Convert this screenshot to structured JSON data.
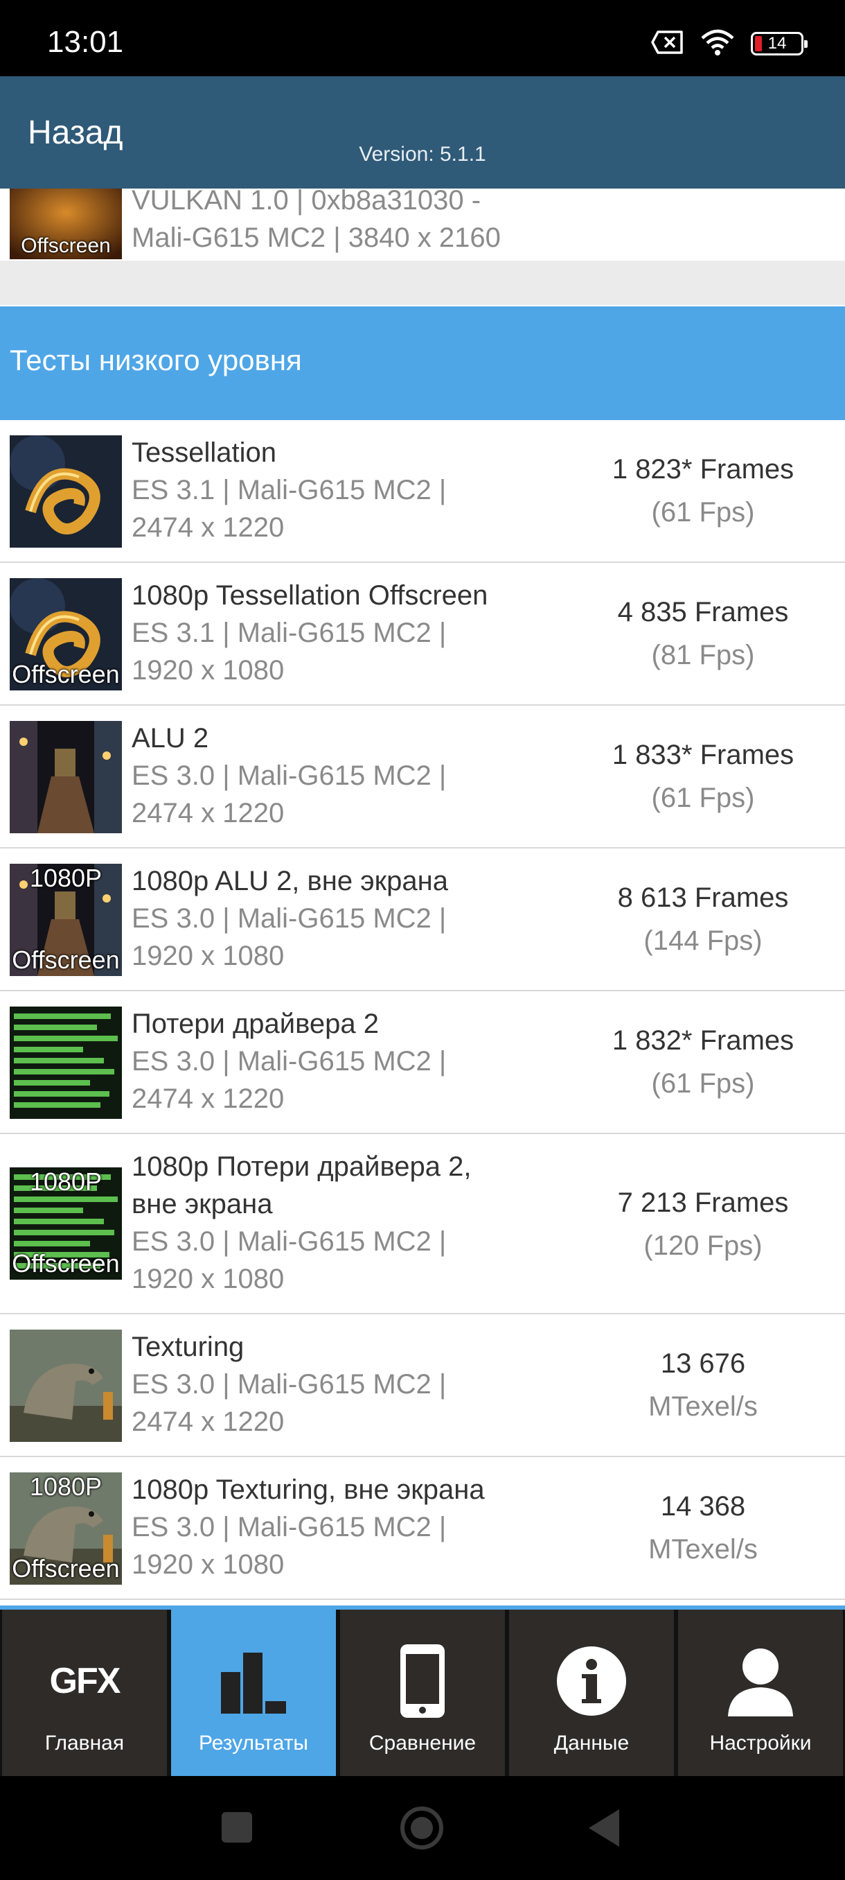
{
  "status_bar": {
    "time": "13:01",
    "battery": "14"
  },
  "header": {
    "back": "Назад",
    "version": "Version: 5.1.1"
  },
  "previous_item": {
    "thumb_label": "Offscreen",
    "line1": "VULKAN 1.0 | 0xb8a31030 -",
    "line2": "Mali-G615 MC2 | 3840 x 2160"
  },
  "section": {
    "title": "Тесты низкого уровня"
  },
  "tests": [
    {
      "title": "Tessellation",
      "sub1": "ES 3.1 | Mali-G615 MC2 |",
      "sub2": "2474 x 1220",
      "result": "1 823* Frames",
      "result_sub": "(61 Fps)",
      "thumb": "tess",
      "badge_top": "",
      "badge_bottom": ""
    },
    {
      "title": "1080p Tessellation Offscreen",
      "sub1": "ES 3.1 | Mali-G615 MC2 |",
      "sub2": "1920 x 1080",
      "result": "4 835 Frames",
      "result_sub": "(81 Fps)",
      "thumb": "tess",
      "badge_top": "",
      "badge_bottom": "Offscreen"
    },
    {
      "title": "ALU 2",
      "sub1": "ES 3.0 | Mali-G615 MC2 |",
      "sub2": "2474 x 1220",
      "result": "1 833* Frames",
      "result_sub": "(61 Fps)",
      "thumb": "alu",
      "badge_top": "",
      "badge_bottom": ""
    },
    {
      "title": "1080p ALU 2, вне экрана",
      "sub1": "ES 3.0 | Mali-G615 MC2 |",
      "sub2": "1920 x 1080",
      "result": "8 613 Frames",
      "result_sub": "(144 Fps)",
      "thumb": "alu",
      "badge_top": "1080P",
      "badge_bottom": "Offscreen"
    },
    {
      "title": "Потери драйвера 2",
      "sub1": "ES 3.0 | Mali-G615 MC2 |",
      "sub2": "2474 x 1220",
      "result": "1 832* Frames",
      "result_sub": "(61 Fps)",
      "thumb": "driver",
      "badge_top": "",
      "badge_bottom": ""
    },
    {
      "title": "1080p Потери драйвера 2,",
      "title2": "вне экрана",
      "sub1": "ES 3.0 | Mali-G615 MC2 |",
      "sub2": "1920 x 1080",
      "result": "7 213 Frames",
      "result_sub": "(120 Fps)",
      "thumb": "driver",
      "badge_top": "1080P",
      "badge_bottom": "Offscreen"
    },
    {
      "title": "Texturing",
      "sub1": "ES 3.0 | Mali-G615 MC2 |",
      "sub2": "2474 x 1220",
      "result": "13 676",
      "result_sub": "MTexel/s",
      "thumb": "tex",
      "badge_top": "",
      "badge_bottom": ""
    },
    {
      "title": "1080p Texturing, вне экрана",
      "sub1": "ES 3.0 | Mali-G615 MC2 |",
      "sub2": "1920 x 1080",
      "result": "14 368",
      "result_sub": "MTexel/s",
      "thumb": "tex",
      "badge_top": "1080P",
      "badge_bottom": "Offscreen"
    }
  ],
  "tabs": [
    {
      "label": "Главная",
      "icon": "gfx-logo-icon",
      "logo_text": "GFX"
    },
    {
      "label": "Результаты",
      "icon": "bar-chart-icon",
      "active": true
    },
    {
      "label": "Сравнение",
      "icon": "phone-icon"
    },
    {
      "label": "Данные",
      "icon": "info-icon"
    },
    {
      "label": "Настройки",
      "icon": "user-icon"
    }
  ],
  "colors": {
    "header": "#2f5a78",
    "accent": "#4ea6e6",
    "tabbar": "#2e2b29"
  }
}
